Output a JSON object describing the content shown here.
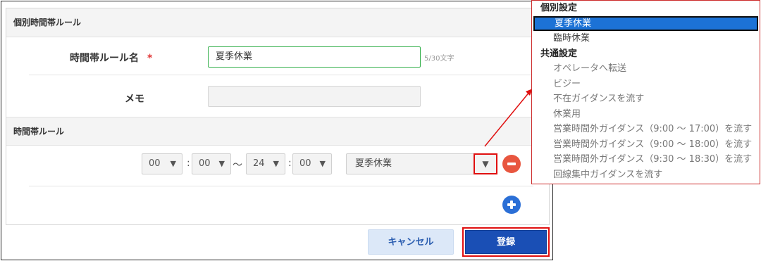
{
  "section_individual": {
    "title": "個別時間帯ルール"
  },
  "form": {
    "name_label": "時間帯ルール名",
    "required_mark": "*",
    "name_value": "夏季休業",
    "name_counter": "5/30文字",
    "memo_label": "メモ",
    "memo_value": ""
  },
  "section_rules": {
    "title": "時間帯ルール"
  },
  "time_row": {
    "start_hour": "00",
    "start_min": "00",
    "colon_1": ":",
    "range_sep": "～",
    "end_hour": "24",
    "end_min": "00",
    "colon_2": ":",
    "rule_selected": "夏季休業",
    "select_arrow": "▼"
  },
  "buttons": {
    "cancel": "キャンセル",
    "register": "登録"
  },
  "dropdown": {
    "group_individual": "個別設定",
    "individual_items": [
      "夏季休業",
      "臨時休業"
    ],
    "group_common": "共通設定",
    "common_items": [
      "オペレータへ転送",
      "ビジー",
      "不在ガイダンスを流す",
      "休業用",
      "営業時間外ガイダンス（9:00 ～ 17:00）を流す",
      "営業時間外ガイダンス（9:00 ～ 18:00）を流す",
      "営業時間外ガイダンス（9:30 ～ 18:30）を流す",
      "回線集中ガイダンスを流す"
    ]
  },
  "icons": {
    "remove_row": "minus-circle-icon",
    "add_row": "plus-circle-icon",
    "dropdown_arrow": "triangle-down-icon"
  },
  "colors": {
    "accent_blue": "#1a4fb5",
    "highlight_red": "#e01010",
    "input_focus_green": "#35b04c",
    "remove_red": "#e8563f",
    "add_blue": "#2b6fd6"
  }
}
